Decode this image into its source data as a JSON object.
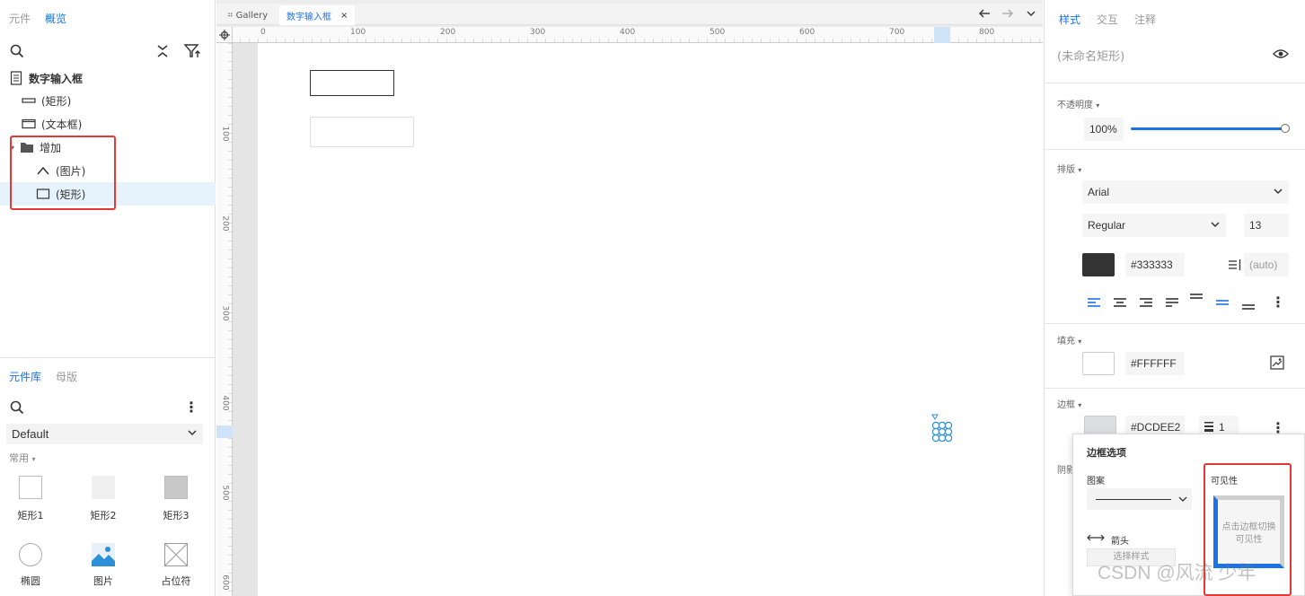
{
  "left_panel": {
    "tabs": [
      "元件",
      "概览"
    ],
    "active_tab_index": 1,
    "tree": {
      "page": "数字输入框",
      "items": [
        {
          "label": "(矩形)",
          "icon": "rectangle-thin-icon",
          "indent": 1
        },
        {
          "label": "(文本框)",
          "icon": "textbox-icon",
          "indent": 1
        },
        {
          "label": "增加",
          "icon": "folder-icon",
          "indent": 1,
          "expanded": true
        },
        {
          "label": "(图片)",
          "icon": "chevron-up-icon",
          "indent": 2
        },
        {
          "label": "(矩形)",
          "icon": "rectangle-icon",
          "indent": 2,
          "selected": true
        }
      ]
    },
    "library": {
      "tabs": [
        "元件库",
        "母版"
      ],
      "active_tab_index": 0,
      "library_select": "Default",
      "section": "常用",
      "items": [
        {
          "label": "矩形1",
          "icon": "rect1-icon"
        },
        {
          "label": "矩形2",
          "icon": "rect2-icon"
        },
        {
          "label": "矩形3",
          "icon": "rect3-icon"
        },
        {
          "label": "椭圆",
          "icon": "ellipse-icon"
        },
        {
          "label": "图片",
          "icon": "image-icon"
        },
        {
          "label": "占位符",
          "icon": "placeholder-icon"
        }
      ]
    }
  },
  "editor": {
    "tabs": [
      {
        "label": "Gallery",
        "active": false
      },
      {
        "label": "数字输入框",
        "active": true,
        "close": "×"
      }
    ],
    "ruler_top": [
      "0",
      "100",
      "200",
      "300",
      "400",
      "500",
      "600",
      "700",
      "800"
    ],
    "ruler_left": [
      "100",
      "200",
      "300",
      "400",
      "500",
      "600"
    ]
  },
  "right_panel": {
    "tabs": [
      "样式",
      "交互",
      "注释"
    ],
    "active_tab_index": 0,
    "name_placeholder": "(未命名矩形)",
    "opacity": {
      "title": "不透明度",
      "value": "100%",
      "level": 1.0
    },
    "typography": {
      "title": "排版",
      "font": "Arial",
      "weight": "Regular",
      "size": "13",
      "color": "#333333",
      "line_height": "(auto)"
    },
    "fill": {
      "title": "填充",
      "color": "#FFFFFF"
    },
    "border": {
      "title": "边框",
      "color": "#DCDEE2",
      "width": "1"
    },
    "shadow_title_partial": "阴影"
  },
  "border_popup": {
    "title": "边框选项",
    "pattern_label": "图案",
    "arrow_label": "箭头",
    "arrow_select": "选择样式",
    "visibility_label": "可见性",
    "visibility_hint": "点击边框切换可见性"
  },
  "watermark": "CSDN @风流 少年",
  "colors": {
    "accent": "#1a73e8",
    "highlight_red": "#e53935",
    "selection_bg": "#e6f2fc"
  }
}
